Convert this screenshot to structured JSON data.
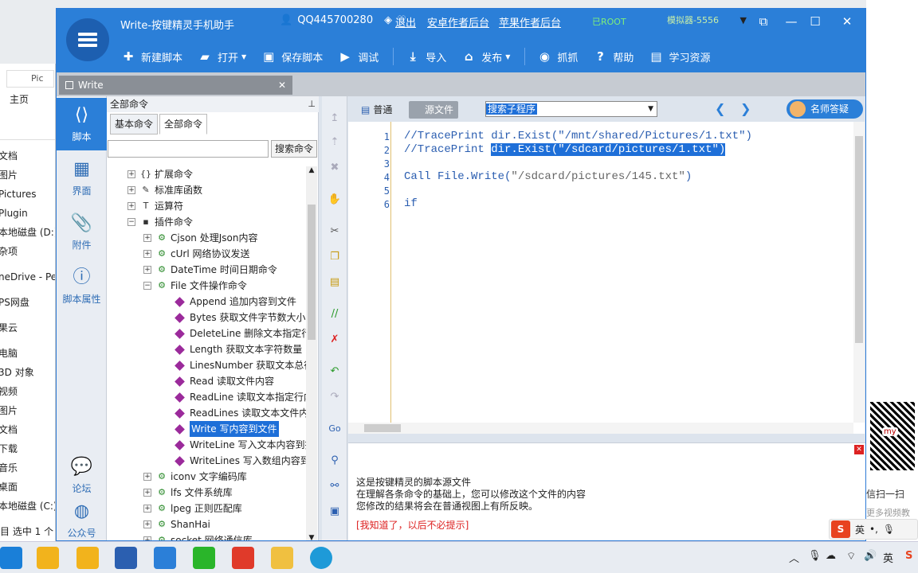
{
  "app": {
    "title": "Write-按键精灵手机助手",
    "qq": "QQ445700280",
    "links": [
      "退出",
      "安卓作者后台",
      "苹果作者后台"
    ],
    "root_badge": "已ROOT",
    "emulator": "模拟器-5556",
    "toolbar": [
      {
        "icon": "plus-icon",
        "label": "新建脚本"
      },
      {
        "icon": "folder-icon",
        "label": "打开"
      },
      {
        "icon": "save-icon",
        "label": "保存脚本"
      },
      {
        "icon": "play-icon",
        "label": "调试"
      },
      {
        "icon": "import-icon",
        "label": "导入"
      },
      {
        "icon": "publish-icon",
        "label": "发布"
      },
      {
        "icon": "camera-icon",
        "label": "抓抓"
      },
      {
        "icon": "help-icon",
        "label": "帮助"
      },
      {
        "icon": "book-icon",
        "label": "学习资源"
      }
    ]
  },
  "doc_tab": {
    "label": "Write"
  },
  "leftnav": [
    {
      "icon": "script-icon",
      "label": "脚本"
    },
    {
      "icon": "ui-icon",
      "label": "界面"
    },
    {
      "icon": "attach-icon",
      "label": "附件"
    },
    {
      "icon": "info-icon",
      "label": "脚本属性"
    },
    {
      "icon": "forum-icon",
      "label": "论坛"
    },
    {
      "icon": "wechat-icon",
      "label": "公众号"
    }
  ],
  "commands": {
    "header": "全部命令",
    "tabs": [
      "基本命令",
      "全部命令"
    ],
    "search_button": "搜索命令",
    "tree": [
      {
        "level": 1,
        "exp": "+",
        "icon": "{}",
        "label": "扩展命令"
      },
      {
        "level": 1,
        "exp": "+",
        "icon": "✎",
        "label": "标准库函数"
      },
      {
        "level": 1,
        "exp": "+",
        "icon": "T",
        "label": "运算符"
      },
      {
        "level": 1,
        "exp": "−",
        "icon": "▪",
        "label": "插件命令"
      },
      {
        "level": 2,
        "exp": "+",
        "icon": "⚙",
        "label": "Cjson 处理Json内容"
      },
      {
        "level": 2,
        "exp": "+",
        "icon": "⚙",
        "label": "cUrl 网络协议发送"
      },
      {
        "level": 2,
        "exp": "+",
        "icon": "⚙",
        "label": "DateTime 时间日期命令"
      },
      {
        "level": 2,
        "exp": "−",
        "icon": "⚙",
        "label": "File 文件操作命令"
      },
      {
        "level": 3,
        "label": "Append 追加内容到文件"
      },
      {
        "level": 3,
        "label": "Bytes 获取文件字节数大小"
      },
      {
        "level": 3,
        "label": "DeleteLine 删除文本指定行"
      },
      {
        "level": 3,
        "label": "Length 获取文本字符数量"
      },
      {
        "level": 3,
        "label": "LinesNumber 获取文本总行"
      },
      {
        "level": 3,
        "label": "Read 读取文件内容"
      },
      {
        "level": 3,
        "label": "ReadLine 读取文本指定行内"
      },
      {
        "level": 3,
        "label": "ReadLines 读取文本文件内"
      },
      {
        "level": 3,
        "label": "Write 写内容到文件",
        "selected": true
      },
      {
        "level": 3,
        "label": "WriteLine 写入文本内容到指"
      },
      {
        "level": 3,
        "label": "WriteLines 写入数组内容到"
      },
      {
        "level": 2,
        "exp": "+",
        "icon": "⚙",
        "label": "iconv 文字编码库"
      },
      {
        "level": 2,
        "exp": "+",
        "icon": "⚙",
        "label": "lfs 文件系统库"
      },
      {
        "level": 2,
        "exp": "+",
        "icon": "⚙",
        "label": "lpeg 正则匹配库"
      },
      {
        "level": 2,
        "exp": "+",
        "icon": "⚙",
        "label": "ShanHai"
      },
      {
        "level": 2,
        "exp": "+",
        "icon": "⚙",
        "label": "socket 网络通信库"
      }
    ]
  },
  "editor": {
    "view_normal": "普通",
    "view_source": "源文件",
    "subroutine_select": "搜索子程序",
    "teacher_button": "名师答疑",
    "lines": [
      {
        "n": "1",
        "parts": [
          {
            "t": "//TracePrint dir.Exist(\"/mnt/shared/Pictures/1.txt\")",
            "c": "cmt"
          }
        ]
      },
      {
        "n": "2",
        "parts": [
          {
            "t": "//TracePrint ",
            "c": "cmt"
          },
          {
            "t": "dir.Exist(\"/sdcard/pictures/1.txt\")",
            "c": "hl"
          }
        ]
      },
      {
        "n": "3",
        "parts": []
      },
      {
        "n": "4",
        "parts": [
          {
            "t": "Call File.Write(",
            "c": "kw"
          },
          {
            "t": "\"/sdcard/pictures/145.txt\"",
            "c": "str"
          },
          {
            "t": ")",
            "c": "kw"
          }
        ]
      },
      {
        "n": "5",
        "parts": []
      },
      {
        "n": "6",
        "parts": [
          {
            "t": "if",
            "c": "kw"
          }
        ]
      }
    ]
  },
  "info": {
    "lines": [
      "这是按键精灵的脚本源文件",
      "在理解各条命令的基础上，您可以修改这个文件的内容",
      "您修改的结果将会在普通视图上有所反映。"
    ],
    "dismiss": "[我知道了，以后不必提示]"
  },
  "background": {
    "explorer": {
      "home": "主页",
      "items": [
        "文档",
        "图片",
        "Pictures",
        "Plugin",
        "本地磁盘 (D:)",
        "杂项",
        "neDrive - Pe",
        "PS网盘",
        "果云",
        "电脑",
        "3D 对象",
        "视频",
        "图片",
        "文档",
        "下载",
        "音乐",
        "桌面",
        "本地磁盘 (C:)"
      ],
      "status": "目   选中 1 个"
    },
    "right": {
      "caption": "信扫一扫",
      "caption2": "更多视频教"
    }
  },
  "taskbar": {
    "ime": "英",
    "tray_lang": "英"
  }
}
